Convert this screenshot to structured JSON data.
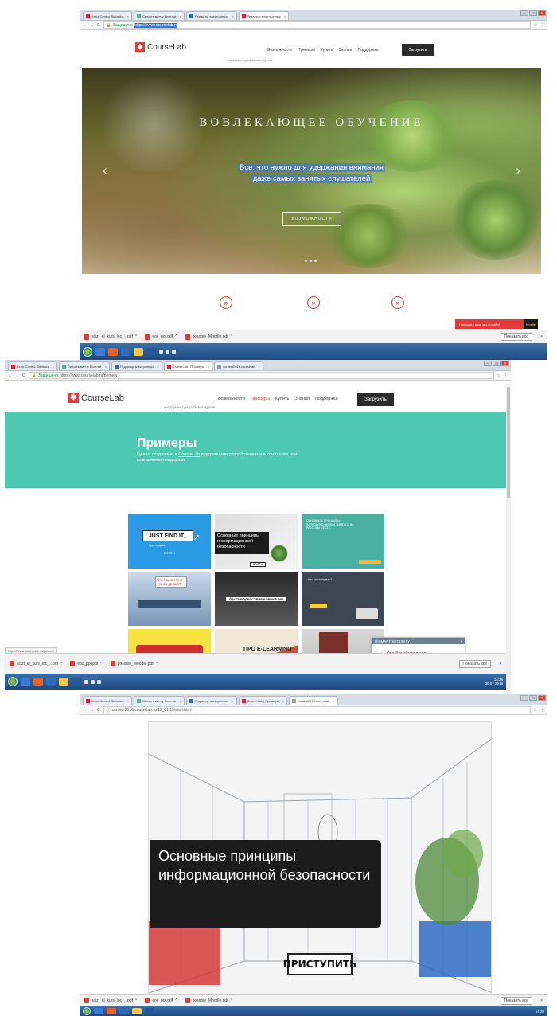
{
  "colors": {
    "accent": "#e33a3a",
    "teal": "#4ec9b1",
    "dark": "#2b2b2b"
  },
  "screen1": {
    "tabs": [
      "Kerio Control Statistics",
      "Скачать винчу бесплат",
      "Редактор электронных",
      "Редактор электронных"
    ],
    "address": {
      "secure": "Защищено",
      "url": "https://www.courselab.ru"
    },
    "logo": "CourseLab",
    "tagline": "инструмент разработки курсов",
    "menu": [
      "Возможности",
      "Примеры",
      "Купить",
      "Знания",
      "Поддержка"
    ],
    "download": "Загрузить",
    "hero": {
      "heading": "ВОВЛЕКАЮЩЕЕ ОБУЧЕНИЕ",
      "line1": "Все, что нужно для удержания внимания",
      "line2": "даже самых занятых слушателей",
      "button": "ВОЗМОЖНОСТИ"
    },
    "chat": {
      "text": "Напишите нам, мы онлайн!",
      "brand": "jivosite"
    },
    "downloads": [
      "scizt_el_kurs_loc_...pdf",
      "eoc_ppi.pdf",
      "posobie_Moodle.pdf"
    ],
    "show_all": "Показать все"
  },
  "screen2": {
    "tabs": [
      "Kerio Control Statistics",
      "Скачать винчу бесплат",
      "Редактор электронных",
      "CourseLab | Примеры",
      "contest2016.courselab"
    ],
    "address": {
      "secure": "Защищено",
      "url": "https://www.courselab.ru/primery"
    },
    "logo": "CourseLab",
    "tagline": "инструмент разработки курсов",
    "menu": [
      "Возможности",
      "Примеры",
      "Купить",
      "Знания",
      "Поддержка"
    ],
    "download": "Загрузить",
    "banner": {
      "title": "Примеры",
      "desc_prefix": "Курсы, созданные в ",
      "desc_brand": "CourseLab",
      "desc_suffix": " внутренними разработчиками в компаниях или компаниями-вендорами"
    },
    "cards": [
      {
        "label": "JUST FIND IT_",
        "sub": "Курс продаж",
        "foot": "ВОЙТИ"
      },
      {
        "label": "Основные принципы информационной безопасности",
        "foot": "ВОЙТИ"
      },
      {
        "label": "ОСНОВНЫЕ ПРИНЦИПЫ ЗДОРОВОГО ОБРАЗА ЖИЗНИ И НА РАБОЧЕМ МЕСТЕ"
      },
      {
        "label": "Что такое HR и что он делает?"
      },
      {
        "label": "ПРОТИВОДЕЙСТВИЕ КОРРУПЦИИ"
      },
      {
        "label": "Что такое сервис?"
      },
      {
        "label": ""
      },
      {
        "label": "ПРО E-LEARNING"
      },
      {
        "label": "Работайте только с лучшими вебинарами"
      }
    ],
    "popup": {
      "header": "DISMART SECURITY",
      "title": "Ошибка обновления",
      "text": "Ошибка подключения к серверу"
    },
    "status_url": "https://www.courselab.ru/primery",
    "downloads": [
      "scizt_el_kurs_loc_...pdf",
      "eoc_ppi.pdf",
      "posobie_Moodle.pdf"
    ],
    "show_all": "Показать все",
    "clock": {
      "time": "14:28",
      "date": "30.07.2018"
    },
    "chat": {
      "text": "Напишите нам, мы онлайн!",
      "brand": "jivosite"
    }
  },
  "screen3": {
    "tabs": [
      "Kerio Control Statistics",
      "Скачать винчу бесплат",
      "Редактор электронных",
      "CourseLab | Примеры",
      "contest2016.courselab"
    ],
    "address": {
      "url": "contest2016.courselab.ru/12_01/11/start.html"
    },
    "title": "Основные принципы информационной безопасности",
    "start": "ПРИСТУПИТЬ",
    "downloads": [
      "scizt_el_kurs_loc_...pdf",
      "eoc_ppi.pdf",
      "posobie_Moodle.pdf"
    ],
    "show_all": "Показать все",
    "clock": {
      "time": "14:28"
    }
  }
}
